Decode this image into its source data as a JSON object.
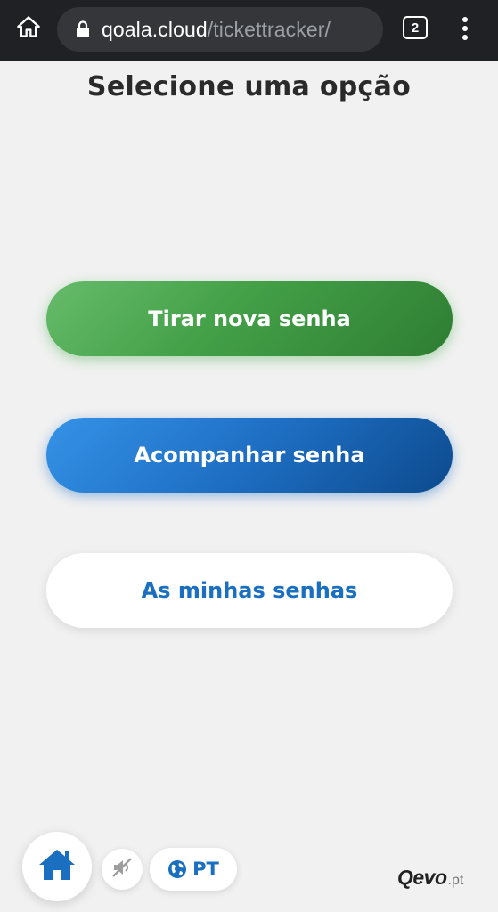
{
  "browser": {
    "url_host": "qoala.cloud",
    "url_path": "/tickettracker/",
    "tab_count": "2",
    "icons": {
      "home": "home-icon",
      "lock": "lock-icon",
      "menu": "more-vert-icon"
    }
  },
  "main": {
    "title": "Selecione uma opção",
    "buttons": [
      {
        "label": "Tirar nova senha",
        "color": "#43a047"
      },
      {
        "label": "Acompanhar senha",
        "color": "#1e6fc4"
      },
      {
        "label": "As minhas senhas",
        "color": "#ffffff"
      }
    ]
  },
  "footer": {
    "language": "PT",
    "brand_main": "Qevo",
    "brand_suffix": ".pt",
    "icons": {
      "home": "home-icon",
      "mute": "sound-off-icon",
      "globe": "globe-icon"
    },
    "accent_color": "#1a6fc0"
  }
}
